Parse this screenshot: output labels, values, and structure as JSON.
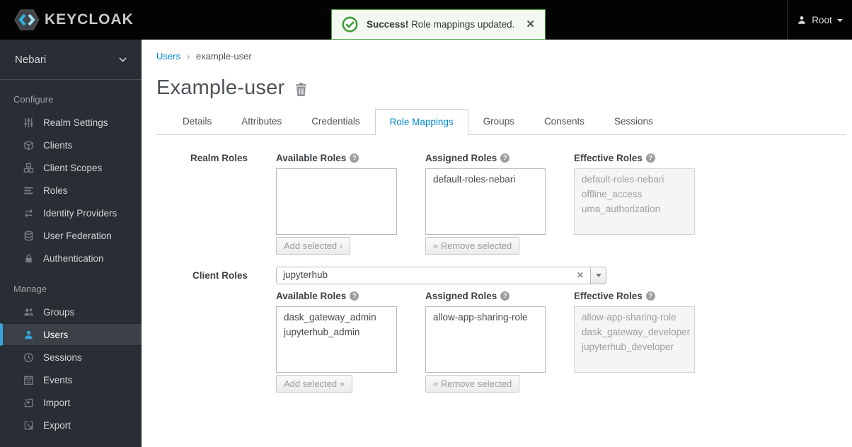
{
  "header": {
    "brand": "KEYCLOAK",
    "alert": {
      "title": "Success!",
      "message": "Role mappings updated.",
      "close": "✕"
    },
    "user": {
      "name": "Root"
    }
  },
  "sidebar": {
    "realm": "Nebari",
    "sections": [
      {
        "label": "Configure",
        "items": [
          {
            "label": "Realm Settings",
            "icon": "sliders-icon"
          },
          {
            "label": "Clients",
            "icon": "cube-icon"
          },
          {
            "label": "Client Scopes",
            "icon": "cubes-icon"
          },
          {
            "label": "Roles",
            "icon": "list-icon"
          },
          {
            "label": "Identity Providers",
            "icon": "exchange-arrows-icon"
          },
          {
            "label": "User Federation",
            "icon": "database-icon"
          },
          {
            "label": "Authentication",
            "icon": "lock-icon"
          }
        ]
      },
      {
        "label": "Manage",
        "items": [
          {
            "label": "Groups",
            "icon": "users-icon"
          },
          {
            "label": "Users",
            "icon": "user-icon",
            "active": true
          },
          {
            "label": "Sessions",
            "icon": "clock-icon"
          },
          {
            "label": "Events",
            "icon": "calendar-icon"
          },
          {
            "label": "Import",
            "icon": "import-icon"
          },
          {
            "label": "Export",
            "icon": "export-icon"
          }
        ]
      }
    ]
  },
  "breadcrumb": {
    "items": [
      "Users",
      "example-user"
    ]
  },
  "page": {
    "title": "Example-user"
  },
  "tabs": [
    {
      "label": "Details"
    },
    {
      "label": "Attributes"
    },
    {
      "label": "Credentials"
    },
    {
      "label": "Role Mappings",
      "active": true
    },
    {
      "label": "Groups"
    },
    {
      "label": "Consents"
    },
    {
      "label": "Sessions"
    }
  ],
  "role_mappings": {
    "realm": {
      "row_label": "Realm Roles",
      "available": {
        "label": "Available Roles",
        "items": [],
        "button": "Add selected ›"
      },
      "assigned": {
        "label": "Assigned Roles",
        "items": [
          "default-roles-nebari"
        ],
        "button": "« Remove selected"
      },
      "effective": {
        "label": "Effective Roles",
        "items": [
          "default-roles-nebari",
          "offline_access",
          "uma_authorization"
        ]
      }
    },
    "client": {
      "row_label": "Client Roles",
      "client_select": {
        "value": "jupyterhub",
        "clear": "✕"
      },
      "available": {
        "label": "Available Roles",
        "items": [
          "dask_gateway_admin",
          "jupyterhub_admin"
        ],
        "button": "Add selected »"
      },
      "assigned": {
        "label": "Assigned Roles",
        "items": [
          "allow-app-sharing-role"
        ],
        "button": "« Remove selected"
      },
      "effective": {
        "label": "Effective Roles",
        "items": [
          "allow-app-sharing-role",
          "dask_gateway_developer",
          "jupyterhub_developer"
        ]
      }
    }
  },
  "colors": {
    "accent": "#0088ce",
    "nav_active": "#39a5dc",
    "success": "#3f9c35"
  }
}
